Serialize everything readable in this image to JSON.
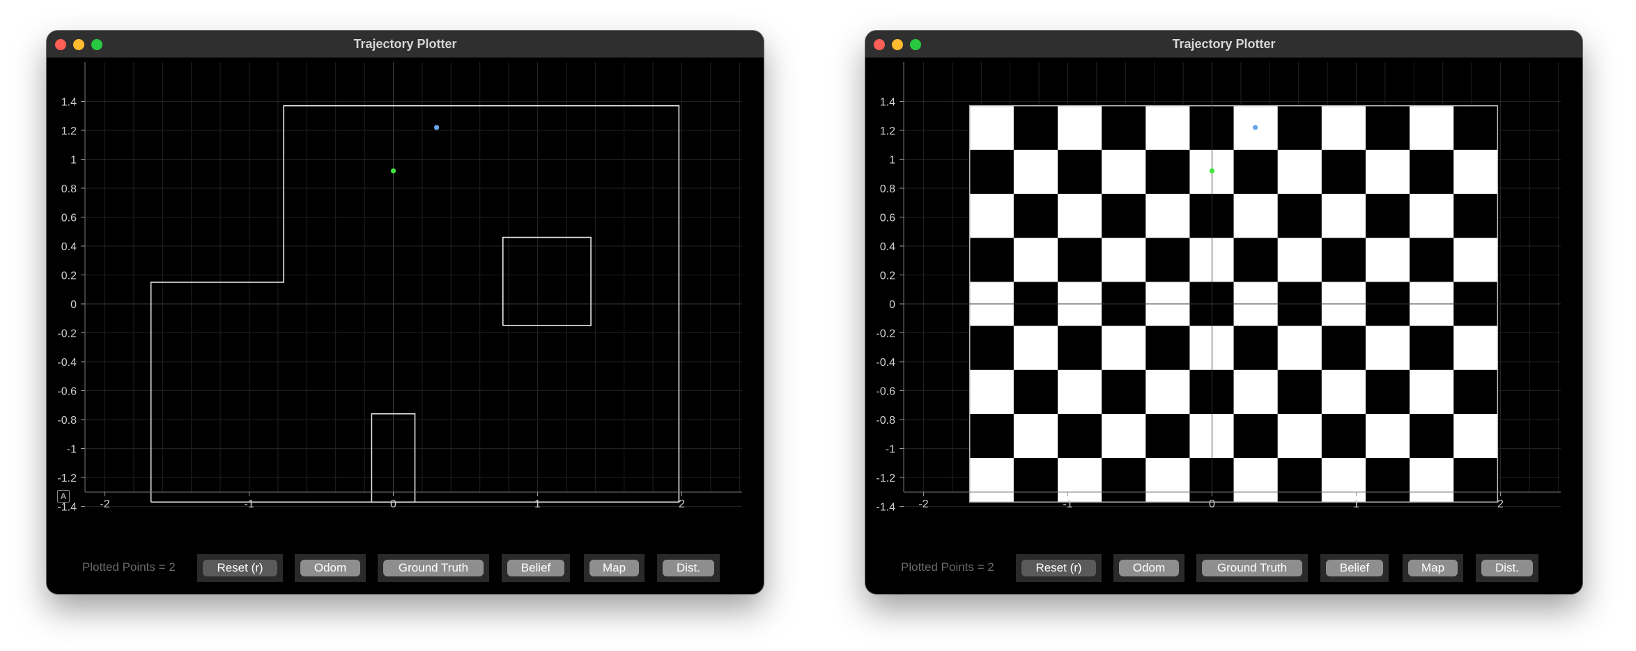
{
  "windows": [
    {
      "title": "Trajectory Plotter",
      "background": "black",
      "plotted_points_label": "Plotted Points = 2",
      "buttons": [
        "Reset (r)",
        "Odom",
        "Ground Truth",
        "Belief",
        "Map",
        "Dist."
      ],
      "auto_button_label": "A"
    },
    {
      "title": "Trajectory Plotter",
      "background": "checkerboard",
      "plotted_points_label": "Plotted Points = 2",
      "buttons": [
        "Reset (r)",
        "Odom",
        "Ground Truth",
        "Belief",
        "Map",
        "Dist."
      ]
    }
  ],
  "colors": {
    "odom_point": "#6aa6f0",
    "ground_truth_point": "#3ee63e",
    "map_line": "#e8e8e8",
    "axis_text": "#d0d0d0",
    "grid": "#222222"
  },
  "chart_data": [
    {
      "type": "scatter",
      "title": "",
      "xlim": [
        -2.2,
        2.4
      ],
      "ylim": [
        -1.45,
        1.42
      ],
      "x_ticks": [
        -2,
        -1,
        0,
        1,
        2
      ],
      "y_ticks": [
        -1.4,
        -1.2,
        -1,
        -0.8,
        -0.6,
        -0.4,
        -0.2,
        0,
        0.2,
        0.4,
        0.6,
        0.8,
        1,
        1.2,
        1.4
      ],
      "grid": true,
      "series": [
        {
          "marker": "odom",
          "x": [
            0.3
          ],
          "y": [
            1.22
          ]
        },
        {
          "marker": "ground_truth",
          "x": [
            0.0
          ],
          "y": [
            0.92
          ]
        }
      ],
      "map_outline": [
        [
          -1.68,
          -1.37
        ],
        [
          1.98,
          -1.37
        ],
        [
          1.98,
          1.37
        ],
        [
          -0.76,
          1.37
        ],
        [
          -0.76,
          0.15
        ],
        [
          -1.68,
          0.15
        ],
        [
          -1.68,
          -1.37
        ]
      ],
      "obstacles": [
        [
          [
            0.76,
            -0.15
          ],
          [
            1.37,
            -0.15
          ],
          [
            1.37,
            0.46
          ],
          [
            0.76,
            0.46
          ],
          [
            0.76,
            -0.15
          ]
        ],
        [
          [
            -0.15,
            -1.37
          ],
          [
            0.15,
            -1.37
          ],
          [
            0.15,
            -0.76
          ],
          [
            -0.15,
            -0.76
          ],
          [
            -0.15,
            -1.37
          ]
        ]
      ]
    },
    {
      "type": "scatter",
      "title": "",
      "xlim": [
        -2.2,
        2.4
      ],
      "ylim": [
        -1.45,
        1.42
      ],
      "x_ticks": [
        -2,
        -1,
        0,
        1,
        2
      ],
      "y_ticks": [
        -1.4,
        -1.2,
        -1,
        -0.8,
        -0.6,
        -0.4,
        -0.2,
        0,
        0.2,
        0.4,
        0.6,
        0.8,
        1,
        1.2,
        1.4
      ],
      "grid": true,
      "checkerboard": {
        "x_range": [
          -1.68,
          1.98
        ],
        "y_range": [
          -1.37,
          1.37
        ],
        "cols": 12,
        "rows": 9
      },
      "series": [
        {
          "marker": "odom",
          "x": [
            0.3
          ],
          "y": [
            1.22
          ]
        },
        {
          "marker": "ground_truth",
          "x": [
            0.0
          ],
          "y": [
            0.92
          ]
        }
      ]
    }
  ]
}
